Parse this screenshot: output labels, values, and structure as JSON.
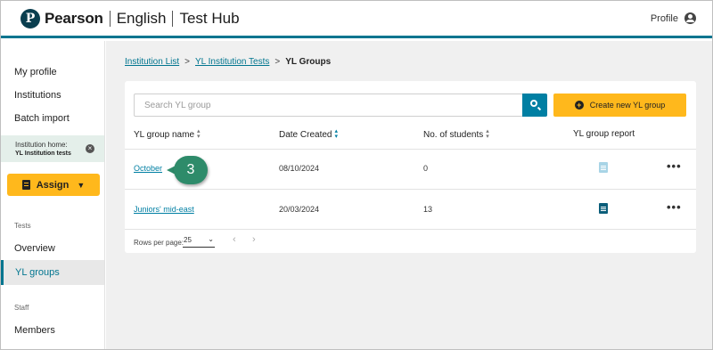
{
  "header": {
    "logo_letter": "P",
    "brand": "Pearson",
    "product": "English",
    "app": "Test Hub",
    "profile_label": "Profile"
  },
  "sidebar": {
    "my_profile": "My profile",
    "institutions": "Institutions",
    "batch_import": "Batch import",
    "institution_home_label": "Institution home:",
    "institution_home_name": "YL Institution tests",
    "assign_label": "Assign",
    "tests_section": "Tests",
    "overview": "Overview",
    "yl_groups": "YL groups",
    "staff_section": "Staff",
    "members": "Members"
  },
  "breadcrumb": {
    "items": [
      "Institution List",
      "YL Institution Tests"
    ],
    "current": "YL Groups",
    "separator": ">"
  },
  "search": {
    "placeholder": "Search YL group"
  },
  "create_button": "Create new YL group",
  "table": {
    "columns": [
      "YL group name",
      "Date Created",
      "No. of students",
      "YL group report"
    ],
    "rows": [
      {
        "name": "October",
        "date": "08/10/2024",
        "students": "0",
        "report_enabled": false
      },
      {
        "name": "Juniors' mid-east",
        "date": "20/03/2024",
        "students": "13",
        "report_enabled": true
      }
    ]
  },
  "pagination": {
    "rows_per_page_label": "Rows per page:",
    "rows_per_page_value": "25",
    "prev": "‹",
    "next": "›"
  },
  "callout": {
    "step": "3"
  },
  "colors": {
    "accent": "#007fa3",
    "brand_yellow": "#ffb81c",
    "callout_green": "#2e8b6a",
    "report_disabled": "#a8d4e6",
    "report_enabled": "#0b5e7a"
  }
}
